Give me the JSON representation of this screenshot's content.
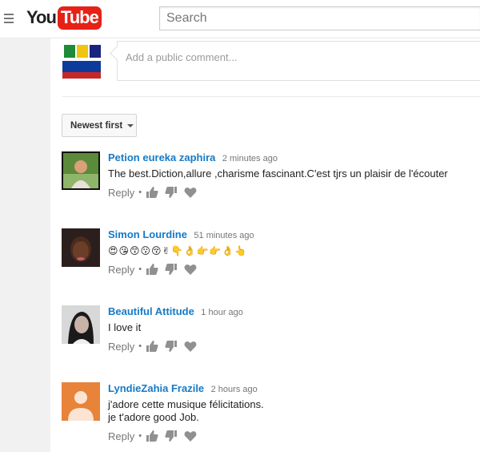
{
  "header": {
    "logo_you": "You",
    "logo_tube": "Tube",
    "search_placeholder": "Search"
  },
  "composer": {
    "placeholder": "Add a public comment..."
  },
  "sort": {
    "label": "Newest first"
  },
  "comments": [
    {
      "author": "Petion eureka zaphira",
      "time": "2 minutes ago",
      "lines": [
        "The best.Diction,allure ,charisme fascinant.C'est tjrs un plaisir de l'écouter"
      ],
      "reply": "Reply"
    },
    {
      "author": "Simon Lourdine",
      "time": "51 minutes ago",
      "lines": [
        "😍😘😙😗😚✌👇👌👉👉👌👆"
      ],
      "reply": "Reply"
    },
    {
      "author": "Beautiful Attitude",
      "time": "1 hour ago",
      "lines": [
        "I love it"
      ],
      "reply": "Reply"
    },
    {
      "author": "LyndieZahia Frazile",
      "time": "2 hours ago",
      "lines": [
        "j'adore cette musique félicitations.",
        "je t'adore good Job."
      ],
      "reply": "Reply"
    }
  ],
  "icons": {
    "menu": "menu-icon",
    "like": "thumbs-up-icon",
    "dislike": "thumbs-down-icon",
    "heart": "heart-icon"
  },
  "colors": {
    "brand_red": "#e62117",
    "author_blue": "#167ac6",
    "meta_gray": "#767676"
  }
}
